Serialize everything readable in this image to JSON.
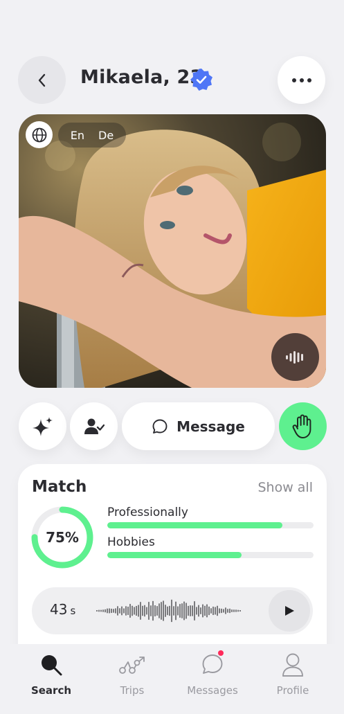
{
  "header": {
    "back_icon": "chevron-left-icon",
    "title": "Mikaela, 23",
    "verified_icon": "verified-badge-icon",
    "more_icon": "ellipsis-icon",
    "verified_color": "#4f76f6"
  },
  "photo": {
    "languages": [
      "En",
      "De"
    ],
    "globe_icon": "globe-chat-icon",
    "audio_icon": "audio-wave-icon"
  },
  "actions": {
    "sparkle_icon": "sparkle-icon",
    "person_icon": "person-check-icon",
    "message_label": "Message",
    "message_icon": "chat-bubble-icon",
    "wave_icon": "hand-wave-icon",
    "accent": "#5ef08f"
  },
  "match": {
    "title": "Match",
    "show_all": "Show all",
    "overall_percent": 75,
    "overall_label": "75%",
    "categories": [
      {
        "label": "Professionally",
        "fraction": 0.85
      },
      {
        "label": "Hobbies",
        "fraction": 0.65
      }
    ],
    "voice": {
      "duration": "43",
      "unit": "s",
      "play_icon": "play-icon"
    }
  },
  "nav": {
    "items": [
      {
        "label": "Search",
        "icon": "search-icon",
        "active": true
      },
      {
        "label": "Trips",
        "icon": "route-icon",
        "active": false
      },
      {
        "label": "Messages",
        "icon": "chat-icon",
        "active": false,
        "badge": true
      },
      {
        "label": "Profile",
        "icon": "profile-icon",
        "active": false
      }
    ],
    "badge_color": "#ff2a5a"
  }
}
